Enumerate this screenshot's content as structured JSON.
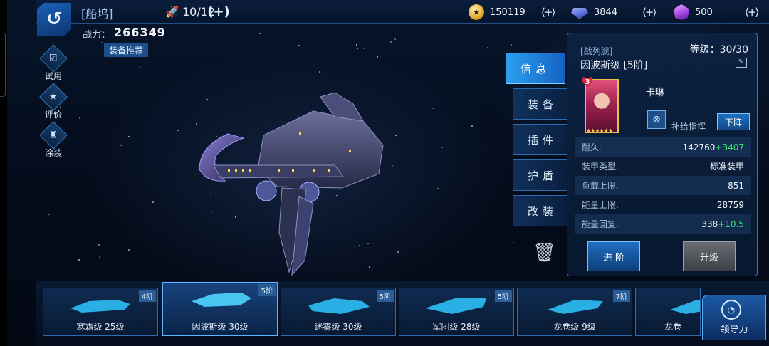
{
  "topbar": {
    "title": "[船坞]",
    "slots": "10/12",
    "coins": "150119",
    "crystals": "3844",
    "gems": "500"
  },
  "power": {
    "label": "战力：",
    "value": "266349",
    "recommend": "装备推荐"
  },
  "side_menu": [
    {
      "label": "试用",
      "icon": "checkbox-icon"
    },
    {
      "label": "评价",
      "icon": "rating-icon"
    },
    {
      "label": "涂装",
      "icon": "spray-icon"
    }
  ],
  "tabs": [
    "信息",
    "装备",
    "插件",
    "护盾",
    "改装"
  ],
  "panel": {
    "ship_class": "[战列舰]",
    "ship_name": "因波斯级 [5阶]",
    "level": "等级：30/30",
    "captain_rank": "3",
    "captain_name": "卡琳",
    "skill_label": "补给指挥",
    "unequip": "下阵",
    "stats": [
      {
        "label": "耐久.",
        "value": "142760",
        "bonus": "+3407"
      },
      {
        "label": "装甲类型.",
        "value": "标准装甲",
        "bonus": ""
      },
      {
        "label": "负载上限.",
        "value": "851",
        "bonus": ""
      },
      {
        "label": "能量上限.",
        "value": "28759",
        "bonus": ""
      },
      {
        "label": "能量回复.",
        "value": "338",
        "bonus": "+10.5"
      }
    ],
    "advance": "进 阶",
    "upgrade": "升级"
  },
  "ships": [
    {
      "name": "寒霜级 25级",
      "rank": "4阶"
    },
    {
      "name": "因波斯级 30级",
      "rank": "5阶"
    },
    {
      "name": "迷雾级 30级",
      "rank": "5阶"
    },
    {
      "name": "军团级 28级",
      "rank": "5阶"
    },
    {
      "name": "龙卷级 9级",
      "rank": "7阶"
    },
    {
      "name": "龙卷",
      "rank": ""
    }
  ],
  "lead_button": "领导力",
  "colors": {
    "accent": "#2aa0f0",
    "bonus": "#39e07a",
    "panel_border": "#2f76c4"
  }
}
